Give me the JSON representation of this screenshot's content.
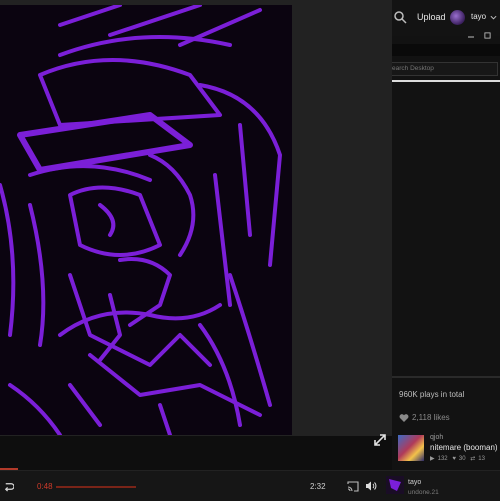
{
  "header": {
    "upload_label": "Upload",
    "username": "tayo"
  },
  "search": {
    "placeholder": "earch Desktop"
  },
  "stats": {
    "plays_text": "960K plays in total",
    "likes_text": "2,118 likes"
  },
  "track_card": {
    "user": "qjoh",
    "title": "nitemare (booman)",
    "plays": "132",
    "likes": "30",
    "reposts": "13"
  },
  "player": {
    "current_time": "0:48",
    "total_time": "2:32",
    "progress_fraction": 0.0,
    "now_playing_user": "tayo",
    "now_playing_title": "undone.21"
  },
  "colors": {
    "accent": "#cf3b2a",
    "artwork_line": "#7b1fd8",
    "artwork_bg": "#0b0410"
  },
  "icons": {
    "search": "search-icon",
    "expand": "expand-icon",
    "repeat": "repeat-icon",
    "cast": "cast-icon",
    "volume": "volume-icon",
    "heart": "heart-icon"
  }
}
